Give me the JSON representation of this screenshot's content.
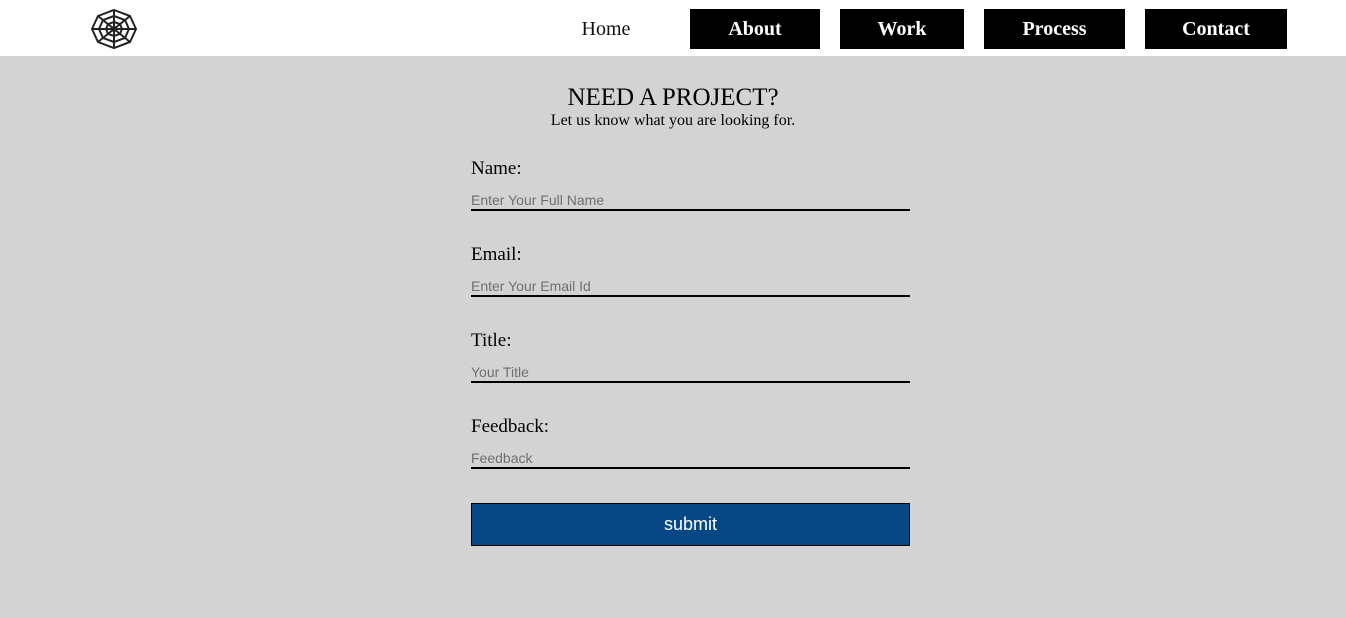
{
  "header": {
    "logo_icon": "spider-web-icon",
    "nav": {
      "home": "Home",
      "about": "About",
      "work": "Work",
      "process": "Process",
      "contact": "Contact"
    }
  },
  "main": {
    "title": "NEED A PROJECT?",
    "subtitle": "Let us know what you are looking for.",
    "form": {
      "name_label": "Name:",
      "name_placeholder": "Enter Your Full Name",
      "email_label": "Email:",
      "email_placeholder": "Enter Your Email Id",
      "title_label": "Title:",
      "title_placeholder": "Your Title",
      "feedback_label": "Feedback:",
      "feedback_placeholder": "Feedback",
      "submit_label": "submit"
    }
  },
  "colors": {
    "background": "#d3d3d3",
    "header_bg": "#ffffff",
    "nav_button_bg": "#000000",
    "submit_bg": "#074785"
  }
}
